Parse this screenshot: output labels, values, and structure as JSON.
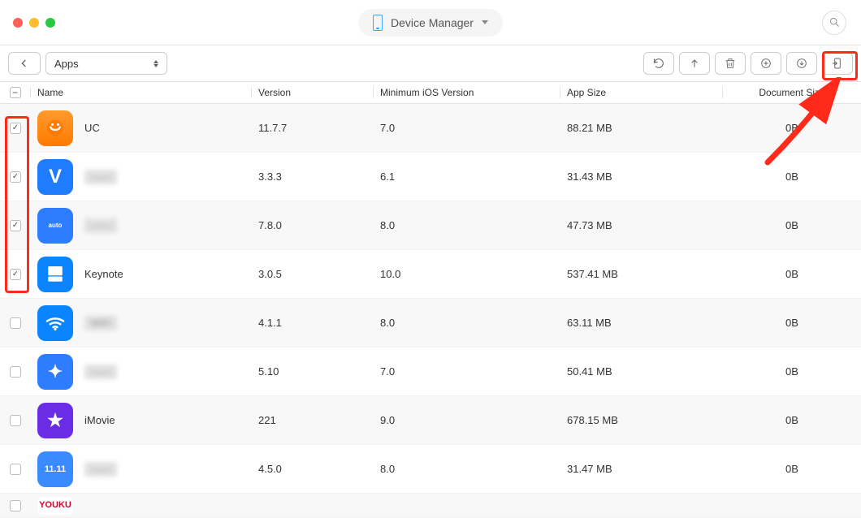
{
  "titlebar": {
    "title": "Device Manager"
  },
  "toolbar": {
    "select_label": "Apps"
  },
  "columns": {
    "name": "Name",
    "version": "Version",
    "min_ios": "Minimum iOS Version",
    "app_size": "App Size",
    "doc_size": "Document Size"
  },
  "rows": [
    {
      "checked": true,
      "icon": "ic-uc",
      "icon_text": "UC",
      "name": "UC",
      "blurred": false,
      "version": "11.7.7",
      "min_ios": "7.0",
      "app_size": "88.21 MB",
      "doc_size": "0B"
    },
    {
      "checked": true,
      "icon": "ic-v",
      "icon_text": "V",
      "name": "——",
      "blurred": true,
      "version": "3.3.3",
      "min_ios": "6.1",
      "app_size": "31.43 MB",
      "doc_size": "0B"
    },
    {
      "checked": true,
      "icon": "ic-auto",
      "icon_text": "auto",
      "name": "——",
      "blurred": true,
      "version": "7.8.0",
      "min_ios": "8.0",
      "app_size": "47.73 MB",
      "doc_size": "0B"
    },
    {
      "checked": true,
      "icon": "ic-key",
      "icon_text": "",
      "name": "Keynote",
      "blurred": false,
      "version": "3.0.5",
      "min_ios": "10.0",
      "app_size": "537.41 MB",
      "doc_size": "0B"
    },
    {
      "checked": false,
      "icon": "ic-wifi",
      "icon_text": "",
      "name": "WiFi",
      "blurred": true,
      "version": "4.1.1",
      "min_ios": "8.0",
      "app_size": "63.11 MB",
      "doc_size": "0B"
    },
    {
      "checked": false,
      "icon": "ic-thunder",
      "icon_text": "✦",
      "name": "——",
      "blurred": true,
      "version": "5.10",
      "min_ios": "7.0",
      "app_size": "50.41 MB",
      "doc_size": "0B"
    },
    {
      "checked": false,
      "icon": "ic-star",
      "icon_text": "★",
      "name": "iMovie",
      "blurred": false,
      "version": "221",
      "min_ios": "9.0",
      "app_size": "678.15 MB",
      "doc_size": "0B"
    },
    {
      "checked": false,
      "icon": "ic-blank",
      "icon_text": "11.11",
      "name": "——",
      "blurred": true,
      "version": "4.5.0",
      "min_ios": "8.0",
      "app_size": "31.47 MB",
      "doc_size": "0B"
    }
  ],
  "partial_row": {
    "icon": "ic-youku",
    "icon_text": "YOUKU"
  }
}
